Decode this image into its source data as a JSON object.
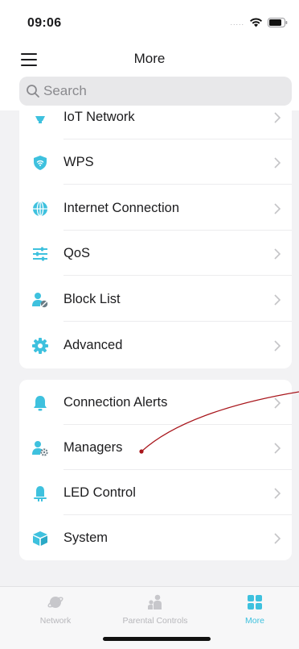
{
  "status_bar": {
    "time": "09:06",
    "signal": "....."
  },
  "header": {
    "title": "More"
  },
  "search": {
    "placeholder": "Search"
  },
  "accent_color": "#3ec1de",
  "sections": [
    {
      "items": [
        {
          "label": "IoT Network",
          "icon": "iot-icon"
        },
        {
          "label": "WPS",
          "icon": "wps-shield-icon"
        },
        {
          "label": "Internet Connection",
          "icon": "globe-icon"
        },
        {
          "label": "QoS",
          "icon": "sliders-icon"
        },
        {
          "label": "Block List",
          "icon": "block-user-icon"
        },
        {
          "label": "Advanced",
          "icon": "gear-icon"
        }
      ]
    },
    {
      "items": [
        {
          "label": "Connection Alerts",
          "icon": "bell-icon"
        },
        {
          "label": "Managers",
          "icon": "managers-icon"
        },
        {
          "label": "LED Control",
          "icon": "led-icon"
        },
        {
          "label": "System",
          "icon": "system-box-icon"
        }
      ]
    }
  ],
  "tab_bar": {
    "tabs": [
      {
        "label": "Network",
        "icon": "network-planet-icon",
        "active": false
      },
      {
        "label": "Parental Controls",
        "icon": "parental-controls-icon",
        "active": false
      },
      {
        "label": "More",
        "icon": "more-grid-icon",
        "active": true
      }
    ]
  }
}
